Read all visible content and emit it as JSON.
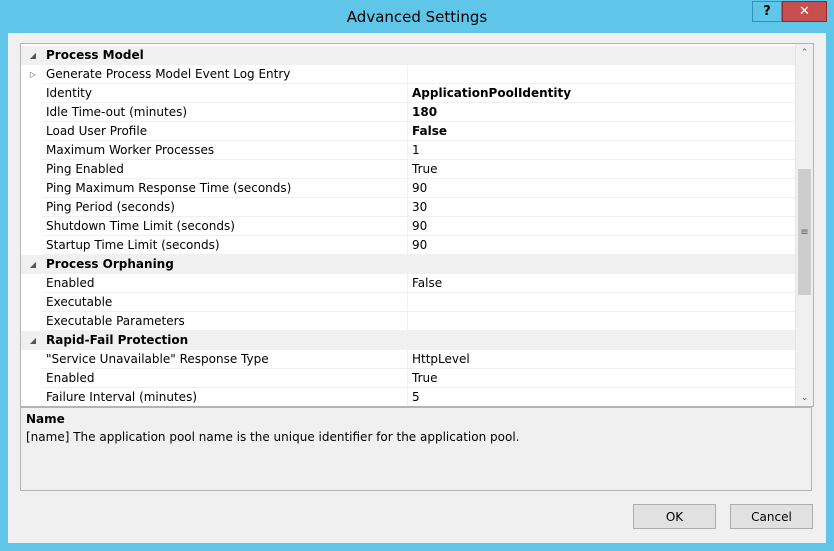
{
  "window": {
    "title": "Advanced Settings",
    "help_label": "?",
    "close_label": "✕"
  },
  "grid": {
    "rows": [
      {
        "type": "category",
        "name": "Process Model"
      },
      {
        "type": "property",
        "name": "Generate Process Model Event Log Entry",
        "value": "",
        "expandable": true
      },
      {
        "type": "property",
        "name": "Identity",
        "value": "ApplicationPoolIdentity",
        "bold": true
      },
      {
        "type": "property",
        "name": "Idle Time-out (minutes)",
        "value": "180",
        "bold": true
      },
      {
        "type": "property",
        "name": "Load User Profile",
        "value": "False",
        "bold": true
      },
      {
        "type": "property",
        "name": "Maximum Worker Processes",
        "value": "1"
      },
      {
        "type": "property",
        "name": "Ping Enabled",
        "value": "True"
      },
      {
        "type": "property",
        "name": "Ping Maximum Response Time (seconds)",
        "value": "90"
      },
      {
        "type": "property",
        "name": "Ping Period (seconds)",
        "value": "30"
      },
      {
        "type": "property",
        "name": "Shutdown Time Limit (seconds)",
        "value": "90"
      },
      {
        "type": "property",
        "name": "Startup Time Limit (seconds)",
        "value": "90"
      },
      {
        "type": "category",
        "name": "Process Orphaning"
      },
      {
        "type": "property",
        "name": "Enabled",
        "value": "False"
      },
      {
        "type": "property",
        "name": "Executable",
        "value": ""
      },
      {
        "type": "property",
        "name": "Executable Parameters",
        "value": ""
      },
      {
        "type": "category",
        "name": "Rapid-Fail Protection"
      },
      {
        "type": "property",
        "name": "\"Service Unavailable\" Response Type",
        "value": "HttpLevel"
      },
      {
        "type": "property",
        "name": "Enabled",
        "value": "True"
      },
      {
        "type": "property",
        "name": "Failure Interval (minutes)",
        "value": "5"
      }
    ],
    "scroll_thumb_glyph": "≡"
  },
  "description": {
    "title": "Name",
    "text": "[name] The application pool name is the unique identifier for the application pool."
  },
  "buttons": {
    "ok": "OK",
    "cancel": "Cancel"
  },
  "icons": {
    "collapse": "◢",
    "expand": "▷",
    "scroll_up": "⌃",
    "scroll_down": "⌄"
  },
  "colors": {
    "titlebar": "#5fc5e9",
    "close": "#c7504f",
    "dialog_bg": "#f0f0f0"
  }
}
